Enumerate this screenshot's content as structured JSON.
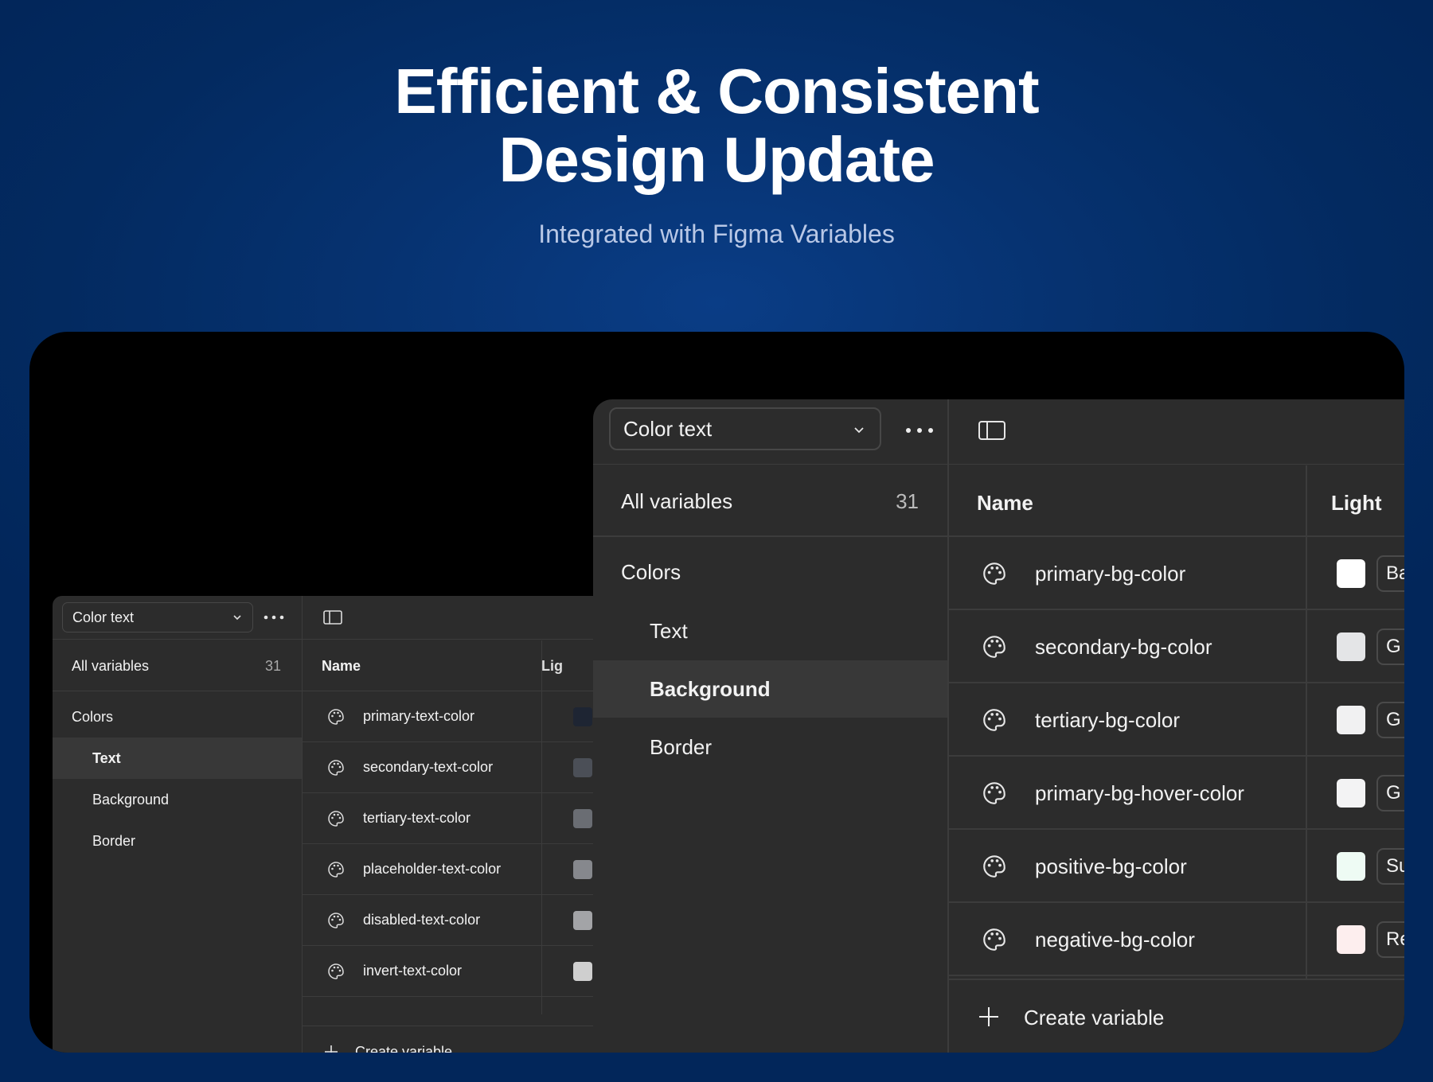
{
  "hero": {
    "title_line1": "Efficient & Consistent",
    "title_line2": "Design Update",
    "subtitle": "Integrated with Figma Variables"
  },
  "colors": {
    "panel_bg": "#2c2c2c",
    "stage_bg": "#000000",
    "selected_row": "#383838"
  },
  "small_panel": {
    "collection_select": "Color text",
    "all_variables_label": "All variables",
    "all_variables_count": "31",
    "groups": [
      {
        "label": "Colors"
      },
      {
        "label": "Text",
        "selected": true
      },
      {
        "label": "Background"
      },
      {
        "label": "Border"
      }
    ],
    "columns": {
      "name": "Name",
      "light": "Lig"
    },
    "variables": [
      {
        "name": "primary-text-color",
        "swatch": "#1e2533"
      },
      {
        "name": "secondary-text-color",
        "swatch": "#4b4f57"
      },
      {
        "name": "tertiary-text-color",
        "swatch": "#6a6d73"
      },
      {
        "name": "placeholder-text-color",
        "swatch": "#86888d"
      },
      {
        "name": "disabled-text-color",
        "swatch": "#a3a4a7"
      },
      {
        "name": "invert-text-color",
        "swatch": "#cfcfcf"
      }
    ],
    "create_label": "Create variable"
  },
  "big_panel": {
    "collection_select": "Color text",
    "all_variables_label": "All variables",
    "all_variables_count": "31",
    "groups": [
      {
        "label": "Colors"
      },
      {
        "label": "Text"
      },
      {
        "label": "Background",
        "selected": true
      },
      {
        "label": "Border"
      }
    ],
    "columns": {
      "name": "Name",
      "light": "Light"
    },
    "variables": [
      {
        "name": "primary-bg-color",
        "swatch": "#ffffff",
        "alias": "Ba"
      },
      {
        "name": "secondary-bg-color",
        "swatch": "#e4e5e7",
        "alias": "G"
      },
      {
        "name": "tertiary-bg-color",
        "swatch": "#f1f1f2",
        "alias": "G"
      },
      {
        "name": "primary-bg-hover-color",
        "swatch": "#f3f3f4",
        "alias": "G"
      },
      {
        "name": "positive-bg-color",
        "swatch": "#eefbf4",
        "alias": "Su"
      },
      {
        "name": "negative-bg-color",
        "swatch": "#fdeeee",
        "alias": "Re"
      }
    ],
    "create_label": "Create variable"
  }
}
